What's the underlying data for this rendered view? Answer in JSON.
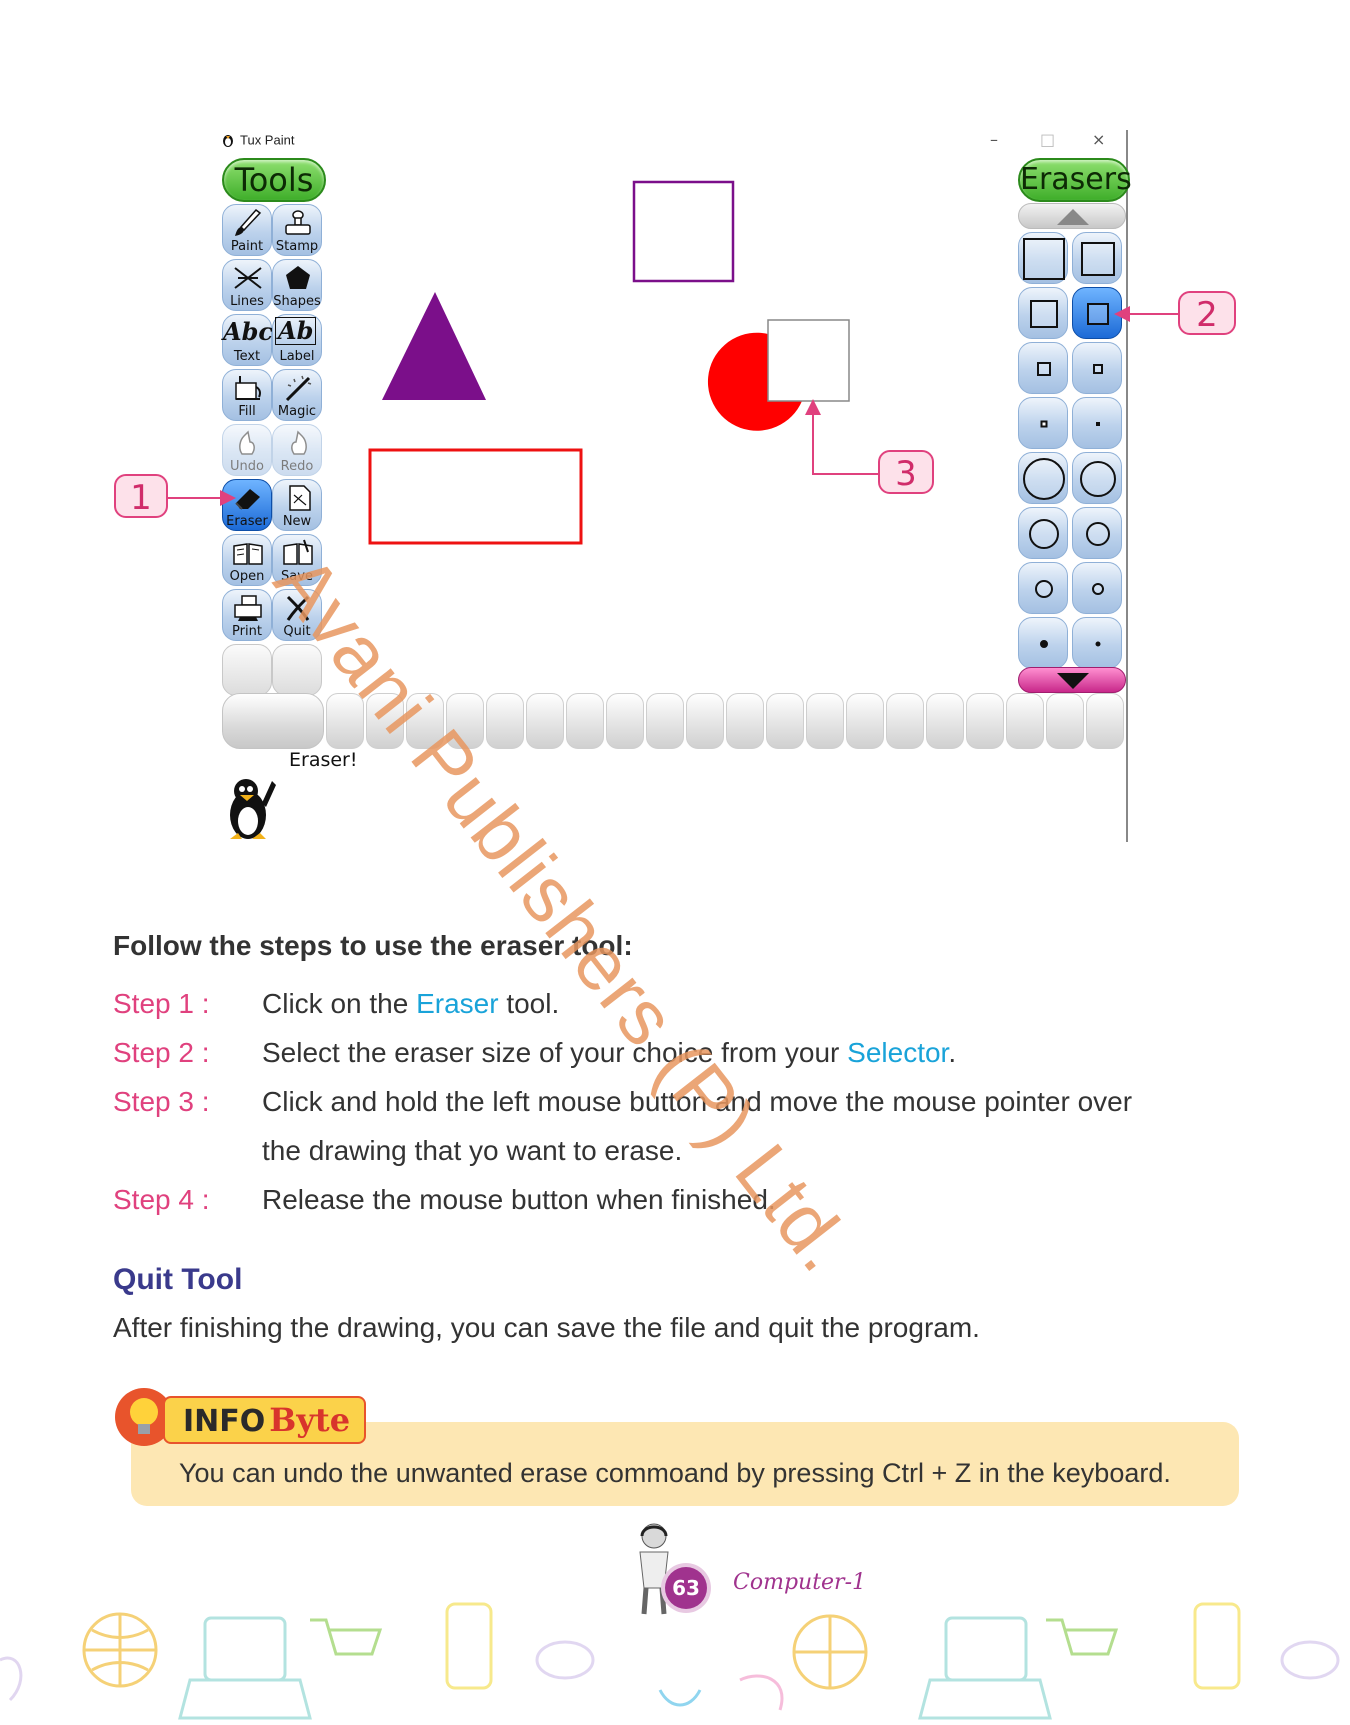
{
  "window": {
    "title": "Tux Paint",
    "controls": {
      "minimize": "–",
      "maximize": "□",
      "close": "×"
    }
  },
  "tools": {
    "header": "Tools",
    "items": [
      {
        "label": "Paint",
        "icon": "paint-brush-icon"
      },
      {
        "label": "Stamp",
        "icon": "stamp-icon"
      },
      {
        "label": "Lines",
        "icon": "lines-icon"
      },
      {
        "label": "Shapes",
        "icon": "shapes-icon"
      },
      {
        "label": "Text",
        "icon": "text-abc-icon"
      },
      {
        "label": "Label",
        "icon": "label-icon"
      },
      {
        "label": "Fill",
        "icon": "fill-bucket-icon"
      },
      {
        "label": "Magic",
        "icon": "magic-wand-icon"
      },
      {
        "label": "Undo",
        "icon": "undo-icon"
      },
      {
        "label": "Redo",
        "icon": "redo-icon"
      },
      {
        "label": "Eraser",
        "icon": "eraser-icon",
        "selected": true
      },
      {
        "label": "New",
        "icon": "new-page-icon"
      },
      {
        "label": "Open",
        "icon": "open-book-icon"
      },
      {
        "label": "Save",
        "icon": "save-book-icon"
      },
      {
        "label": "Print",
        "icon": "printer-icon"
      },
      {
        "label": "Quit",
        "icon": "quit-x-icon"
      }
    ],
    "text_glyphs": {
      "text": "Abc",
      "label": "Ab"
    }
  },
  "erasers": {
    "header": "Erasers",
    "selected_index": 3
  },
  "status": {
    "message": "Eraser!"
  },
  "callouts": {
    "one": "1",
    "two": "2",
    "three": "3"
  },
  "watermark": "Avani Publishers (P) Ltd.",
  "steps": {
    "heading": "Follow the steps to use the eraser tool:",
    "items": [
      {
        "label": "Step 1 :",
        "pre": "Click on the ",
        "highlight": "Eraser",
        "post": " tool."
      },
      {
        "label": "Step 2 :",
        "pre": "Select the eraser size of your choice from your ",
        "highlight": "Selector",
        "post": "."
      },
      {
        "label": "Step 3 :",
        "line1": "Click and hold the left mouse button and move the mouse pointer over",
        "line2": "the drawing that yo want to erase."
      },
      {
        "label": "Step 4 :",
        "text": "Release the mouse button when finished."
      }
    ]
  },
  "quit_tool": {
    "heading": "Quit Tool",
    "text": "After finishing the drawing, you can save the file and quit the program."
  },
  "info_byte": {
    "badge_info": "INFO",
    "badge_byte": "Byte",
    "text": "You can undo the unwanted erase commoand by pressing Ctrl + Z in the keyboard."
  },
  "footer": {
    "page_number": "63",
    "book_title": "Computer-1"
  },
  "colors": {
    "accent_pink": "#e0417e",
    "highlight_blue": "#19a3d9",
    "heading_navy": "#3a3a8c",
    "info_bg": "#fde7b3",
    "triangle": "#7b0f8a",
    "red_shape": "#ff0000"
  }
}
